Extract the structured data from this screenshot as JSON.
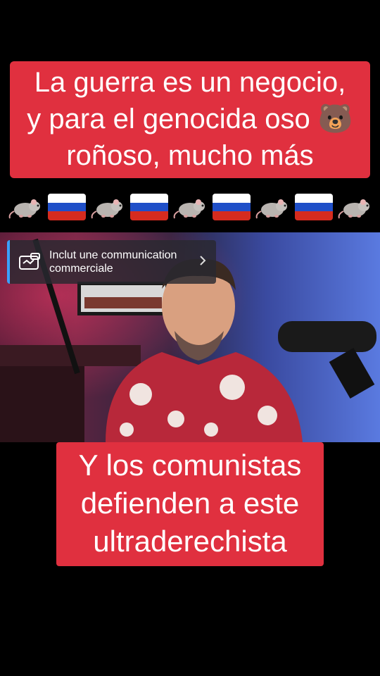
{
  "top_caption": {
    "line1": "La guerra es un negocio,",
    "line2": "y para el genocida oso 🐻",
    "line3": "roñoso, mucho más"
  },
  "emoji_row": [
    "rat-icon",
    "russia-flag-icon",
    "rat-icon",
    "russia-flag-icon",
    "rat-icon",
    "russia-flag-icon",
    "rat-icon",
    "russia-flag-icon",
    "rat-icon"
  ],
  "ad_banner": {
    "text_line1": "Inclut une communication",
    "text_line2": "commerciale"
  },
  "bottom_caption": {
    "line1": "Y los comunistas",
    "line2": "defienden a este",
    "line3": "ultraderechista"
  },
  "colors": {
    "caption_bg": "#e0303f",
    "page_bg": "#000000",
    "ad_accent": "#3aa0ff"
  }
}
